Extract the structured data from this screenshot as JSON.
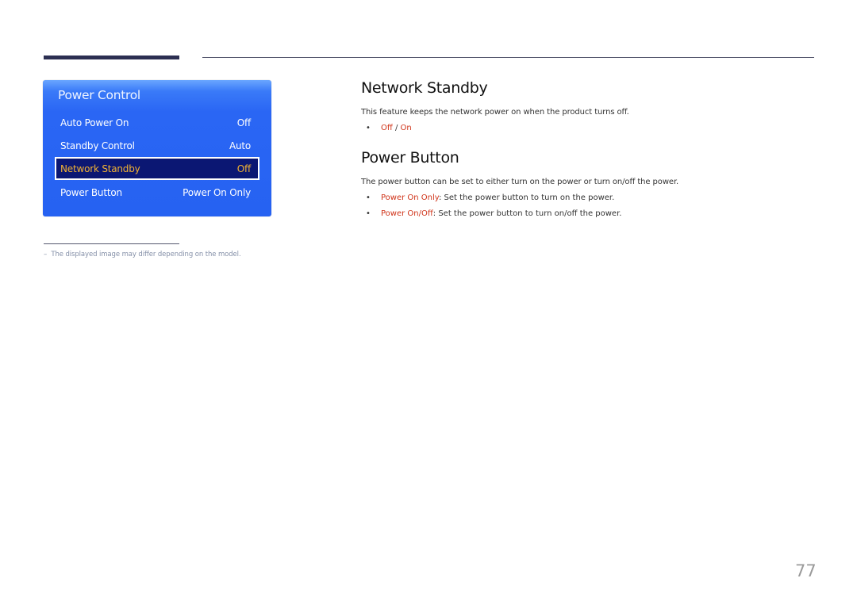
{
  "osd": {
    "title": "Power Control",
    "items": [
      {
        "label": "Auto Power On",
        "value": "Off"
      },
      {
        "label": "Standby Control",
        "value": "Auto"
      },
      {
        "label": "Network Standby",
        "value": "Off"
      },
      {
        "label": "Power Button",
        "value": "Power On Only"
      }
    ],
    "selected_index": 2
  },
  "sections": {
    "network_standby": {
      "heading": "Network Standby",
      "description": "This feature keeps the network power on when the product turns off.",
      "options": {
        "first": "Off",
        "separator": " / ",
        "second": "On"
      }
    },
    "power_button": {
      "heading": "Power Button",
      "description": "The power button can be set to either turn on the power or turn on/off the power.",
      "bullets": [
        {
          "term": "Power On Only",
          "text": ": Set the power button to turn on the power."
        },
        {
          "term": "Power On/Off",
          "text": ": Set the power button to turn on/off the power."
        }
      ]
    }
  },
  "footnote": {
    "dash": "–",
    "text": "The displayed image may differ depending on the model."
  },
  "bullet_char": "•",
  "page_number": "77",
  "colors": {
    "accent_red": "#d0341a",
    "osd_blue": "#2662f2",
    "osd_selected": "#0b1773",
    "osd_selected_text": "#f2b233"
  }
}
